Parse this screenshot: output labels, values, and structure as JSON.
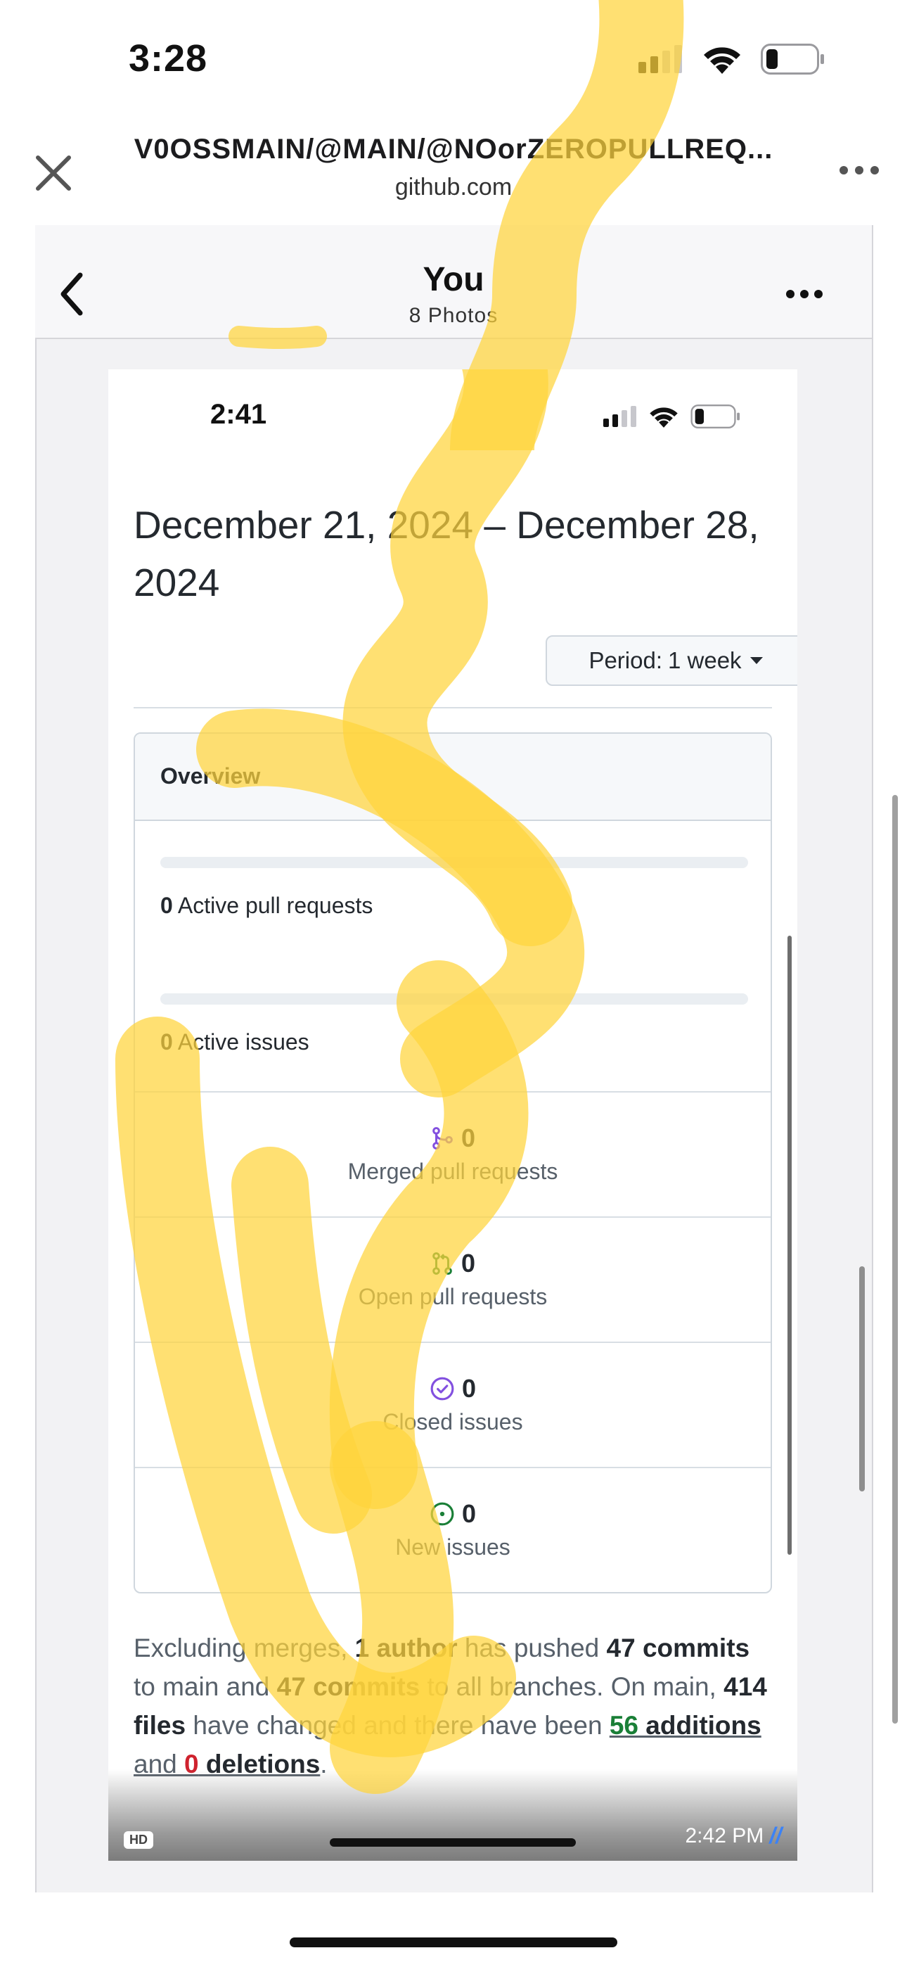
{
  "os_status": {
    "time": "3:28"
  },
  "browser": {
    "title": "V0OSSMAIN/@MAIN/@NOorZEROPULLREQ...",
    "host": "github.com"
  },
  "viewer": {
    "title": "You",
    "subtitle": "8 Photos"
  },
  "screenshot": {
    "status_time": "2:41",
    "date_heading": "December 21, 2024 – December 28, 2024",
    "period": {
      "label": "Period:",
      "value": "1 week"
    },
    "overview": {
      "title": "Overview",
      "active_pull_requests": {
        "count": "0",
        "label": "Active pull requests"
      },
      "active_issues": {
        "count": "0",
        "label": "Active issues"
      },
      "stats": [
        {
          "icon": "merged-pr-icon",
          "count": "0",
          "label": "Merged pull requests",
          "color": "#8250df"
        },
        {
          "icon": "open-pr-icon",
          "count": "0",
          "label": "Open pull requests",
          "color": "#1a7f37"
        },
        {
          "icon": "closed-issue-icon",
          "count": "0",
          "label": "Closed issues",
          "color": "#8250df"
        },
        {
          "icon": "new-issue-icon",
          "count": "0",
          "label": "New issues",
          "color": "#1a7f37"
        }
      ]
    },
    "summary": {
      "t1": "Excluding merges, ",
      "authors": "1 author",
      "t2": " has pushed ",
      "commits_main": "47 commits",
      "t3": " to main and ",
      "commits_all": "47 commits",
      "t4": " to all branches. On main, ",
      "files": "414 files",
      "t5": " have changed and there have been ",
      "additions_num": "56",
      "additions_word": " additions",
      "t6": "and ",
      "deletions_num": "0",
      "deletions_word": " deletions",
      "t7": "."
    },
    "hd_badge": "HD",
    "message_time": "2:42 PM"
  },
  "colors": {
    "accent_purple": "#8250df",
    "accent_green": "#1a7f37",
    "accent_red": "#cf222e",
    "highlight": "#ffd43b"
  }
}
